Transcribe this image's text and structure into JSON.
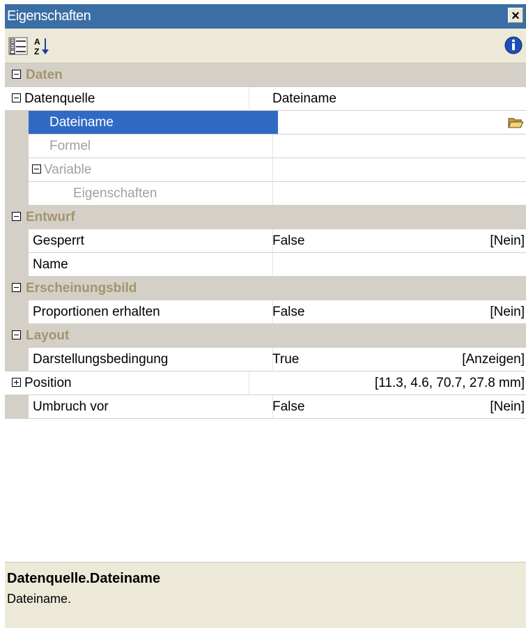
{
  "window": {
    "title": "Eigenschaften",
    "close_glyph": "×"
  },
  "toolbar": {
    "categorized_icon": "categorized-icon",
    "alphabetical_icon": "sort-alphabetical-icon",
    "info_icon": "info-icon"
  },
  "grid": {
    "categories": {
      "daten": "Daten",
      "entwurf": "Entwurf",
      "erscheinungsbild": "Erscheinungsbild",
      "layout": "Layout"
    },
    "rows": {
      "datenquelle": {
        "name": "Datenquelle",
        "value": "Dateiname"
      },
      "dateiname": {
        "name": "Dateiname",
        "value": ""
      },
      "formel": {
        "name": "Formel"
      },
      "variable": {
        "name": "Variable"
      },
      "eigenschaften": {
        "name": "Eigenschaften"
      },
      "gesperrt": {
        "name": "Gesperrt",
        "value": "False",
        "display": "[Nein]"
      },
      "name": {
        "name": "Name",
        "value": ""
      },
      "proportionen": {
        "name": "Proportionen erhalten",
        "value": "False",
        "display": "[Nein]"
      },
      "darstellung": {
        "name": "Darstellungsbedingung",
        "value": "True",
        "display": "[Anzeigen]"
      },
      "position": {
        "name": "Position",
        "display": "[11.3, 4.6, 70.7, 27.8 mm]"
      },
      "umbruch": {
        "name": "Umbruch vor",
        "value": "False",
        "display": "[Nein]"
      }
    }
  },
  "help": {
    "title": "Datenquelle.Dateiname",
    "text": "Dateiname."
  },
  "colors": {
    "titlebar": "#3a6ea5",
    "selection": "#316ac5",
    "category_text": "#a3956b",
    "panel_gray": "#d4d0c8"
  }
}
